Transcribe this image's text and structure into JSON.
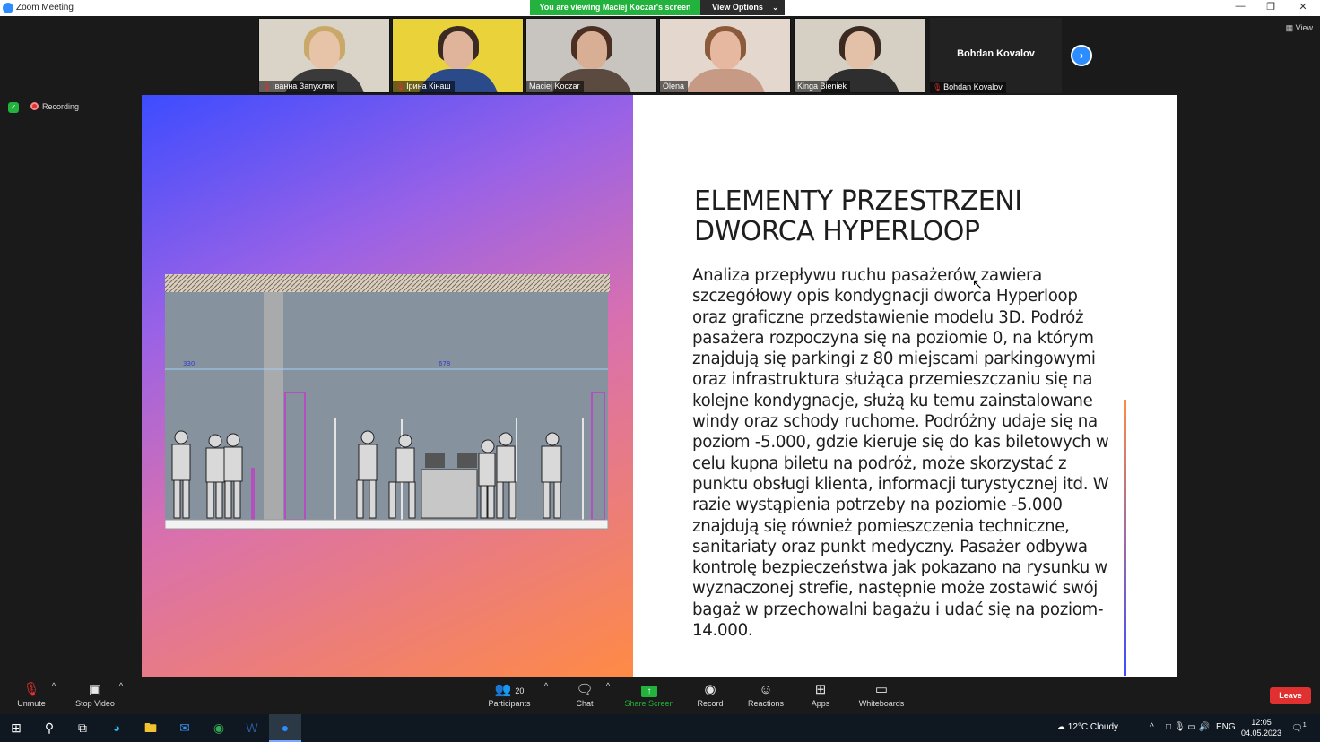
{
  "window": {
    "title": "Zoom Meeting"
  },
  "banner": {
    "viewing": "You are viewing Maciej Koczar's screen",
    "view_options": "View Options"
  },
  "participants_strip": [
    {
      "name": "Іванна Запухляк",
      "muted": true,
      "bg": "#d9d3c8",
      "skin": "#e7c3a8",
      "hair": "#c9a96a",
      "shirt": "#3a3a3a"
    },
    {
      "name": "Ірина Кінаш",
      "muted": true,
      "bg": "#e9d23a",
      "skin": "#e0b49a",
      "hair": "#3b2a22",
      "shirt": "#2a4a8a"
    },
    {
      "name": "Maciej Koczar",
      "muted": false,
      "bg": "#c8c4bf",
      "skin": "#d8ae94",
      "hair": "#4a2f22",
      "shirt": "#5b4a3f"
    },
    {
      "name": "Olena",
      "muted": false,
      "bg": "#e4d7ce",
      "skin": "#e6b8a0",
      "hair": "#8a5a3a",
      "shirt": "#c79a86"
    },
    {
      "name": "Kinga Bieniek",
      "muted": false,
      "bg": "#d6cfc4",
      "skin": "#e3c1a8",
      "hair": "#3a2a22",
      "shirt": "#2e2e2e"
    }
  ],
  "text_tile": {
    "big_name": "Bohdan Kovalov",
    "label": "Bohdan Kovalov"
  },
  "view_button": "View",
  "recording": "Recording",
  "slide": {
    "title_line1": "ELEMENTY PRZESTRZENI",
    "title_line2": "DWORCA HYPERLOOP",
    "body": "Analiza przepływu ruchu pasażerów zawiera szczegółowy opis kondygnacji dworca Hyperloop oraz graficzne przedstawienie modelu 3D. Podróż pasażera rozpoczyna się na poziomie 0, na którym znajdują się parkingi z 80 miejscami parkingowymi oraz infrastruktura służąca przemieszczaniu się na kolejne kondygnacje, służą ku temu zainstalowane windy oraz schody ruchome. Podróżny udaje się na poziom -5.000, gdzie kieruje się do kas biletowych w celu kupna biletu na podróż, może skorzystać z punktu obsługi klienta, informacji turystycznej itd. W razie wystąpienia potrzeby na poziomie -5.000 znajdują się również pomieszczenia techniczne, sanitariaty oraz punkt medyczny. Pasażer odbywa kontrolę bezpieczeństwa jak pokazano na rysunku w wyznaczonej strefie, następnie może zostawić swój bagaż w przechowalni bagażu i udać się na poziom-14.000.",
    "dim_a": "330",
    "dim_b": "678"
  },
  "toolbar": {
    "unmute": "Unmute",
    "stop_video": "Stop Video",
    "participants": "Participants",
    "participants_count": "20",
    "chat": "Chat",
    "share_screen": "Share Screen",
    "record": "Record",
    "reactions": "Reactions",
    "apps": "Apps",
    "whiteboards": "Whiteboards",
    "leave": "Leave"
  },
  "taskbar": {
    "weather": "12°C  Cloudy",
    "lang": "ENG",
    "time": "12:05",
    "date": "04.05.2023",
    "notif": "1"
  },
  "colors": {
    "zoom_blue": "#2d8cff",
    "green": "#22b23d",
    "red": "#e0302f"
  }
}
